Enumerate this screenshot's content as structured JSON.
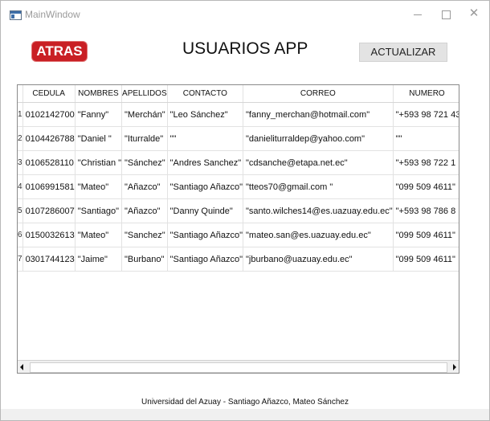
{
  "window": {
    "title": "MainWindow"
  },
  "header": {
    "back_label": "ATRAS",
    "title": "USUARIOS APP",
    "refresh_label": "ACTUALIZAR"
  },
  "table": {
    "columns": [
      "CEDULA",
      "NOMBRES",
      "APELLIDOS",
      "CONTACTO",
      "CORREO",
      "NUMERO"
    ],
    "rows": [
      {
        "num": "1",
        "cells": [
          "0102142700",
          "\"Fanny\"",
          "\"Merchán\"",
          "\"Leo Sánchez\"",
          "\"fanny_merchan@hotmail.com\"",
          "\"+593 98 721 43"
        ]
      },
      {
        "num": "2",
        "cells": [
          "0104426788",
          "\"Daniel \"",
          "\"Iturralde\"",
          "\"\"",
          "\"danieliturraldep@yahoo.com\"",
          "\"\""
        ]
      },
      {
        "num": "3",
        "cells": [
          "0106528110",
          "\"Christian \"",
          "\"Sánchez\"",
          "\"Andres Sanchez\"",
          "\"cdsanche@etapa.net.ec\"",
          "\"+593 98 722 1"
        ]
      },
      {
        "num": "4",
        "cells": [
          "0106991581",
          "\"Mateo\"",
          "\"Añazco\"",
          "\"Santiago Añazco\"",
          "\"tteos70@gmail.com \"",
          "\"099 509 4611\""
        ]
      },
      {
        "num": "5",
        "cells": [
          "0107286007",
          "\"Santiago\"",
          "\"Añazco\"",
          "\"Danny Quinde\"",
          "\"santo.wilches14@es.uazuay.edu.ec\"",
          "\"+593 98 786 8"
        ]
      },
      {
        "num": "6",
        "cells": [
          "0150032613",
          "\"Mateo\"",
          "\"Sanchez\"",
          "\"Santiago Añazco\"",
          "\"mateo.san@es.uazuay.edu.ec\"",
          "\"099 509 4611\""
        ]
      },
      {
        "num": "7",
        "cells": [
          "0301744123",
          "\"Jaime\"",
          "\"Burbano\"",
          "\"Santiago Añazco\"",
          "\"jburbano@uazuay.edu.ec\"",
          "\"099 509 4611\""
        ]
      }
    ]
  },
  "footer": {
    "text": "Universidad del Azuay - Santiago Añazco, Mateo Sánchez"
  },
  "colors": {
    "back_button": "#c91f24",
    "refresh_button": "#e3e3e3"
  }
}
